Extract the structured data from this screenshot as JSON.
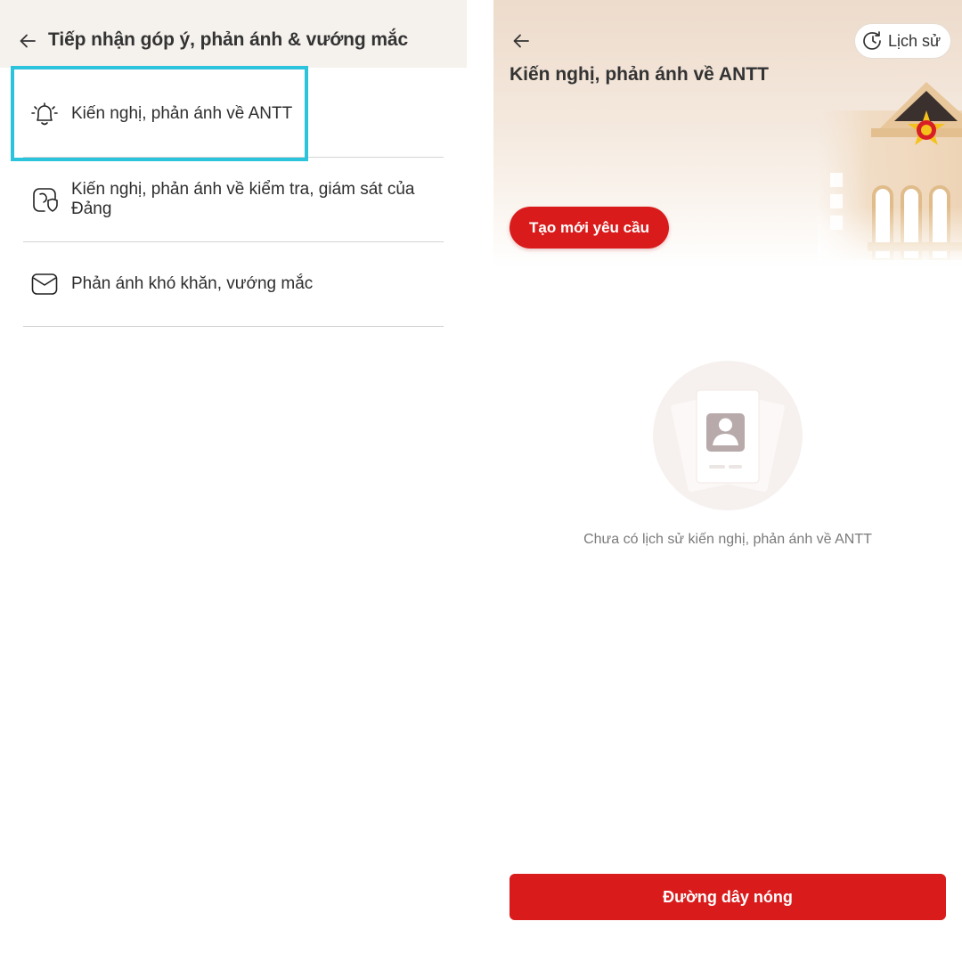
{
  "left_screen": {
    "title": "Tiếp nhận góp ý, phản ánh & vướng mắc",
    "menu_items": [
      {
        "label": "Kiến nghị, phản ánh về ANTT",
        "icon": "alarm-bell-icon"
      },
      {
        "label": "Kiến nghị, phản ánh về kiểm tra, giám sát của Đảng",
        "icon": "party-shield-icon"
      },
      {
        "label": "Phản ánh khó khăn, vướng mắc",
        "icon": "mail-icon"
      }
    ],
    "highlight_color": "#2cc3dc"
  },
  "right_screen": {
    "title": "Kiến nghị, phản ánh về ANTT",
    "history_label": "Lịch sử",
    "create_button_label": "Tạo mới yêu cầu",
    "empty_state_text": "Chưa có lịch sử kiến nghị, phản ánh về ANTT",
    "hotline_button_label": "Đường dây nóng",
    "accent_color": "#d91b1b"
  }
}
